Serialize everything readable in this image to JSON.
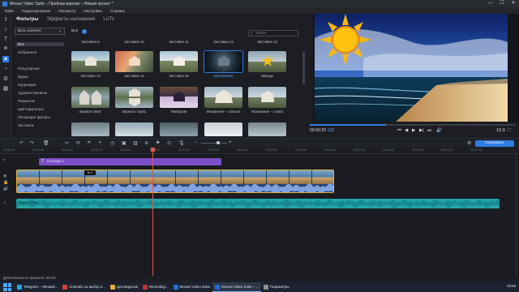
{
  "window": {
    "title": "Movavi Video Suite – Пробная версия – Новый проект *",
    "controls": [
      "—",
      "☐",
      "✕"
    ]
  },
  "menu": [
    "Файл",
    "Редактирование",
    "Просмотр",
    "Настройки",
    "Справка"
  ],
  "library": {
    "tabs": [
      "Фильтры",
      "Эффекты наложения",
      "LUTs"
    ],
    "active_tab": "Фильтры",
    "category_select": "Весь контент",
    "categories": [
      "Все",
      "Избранное",
      "Популярные",
      "Шумы",
      "Коррекция",
      "Художественные",
      "Размытие",
      "Цветофильтры",
      "Летающие фигуры",
      "Заставка"
    ],
    "selected_category": "Все",
    "all_label": "Все",
    "help": "?",
    "search_placeholder": "Поиск",
    "top_row_labels": [
      "Заставка 9",
      "Заставка 10",
      "Заставка 11",
      "Заставка 12",
      "Заставка 13"
    ],
    "effects": [
      {
        "label": "Заставка 14"
      },
      {
        "label": "Заставка 15"
      },
      {
        "label": "Заставка 16"
      },
      {
        "label": "Затемнение",
        "selected": true
      },
      {
        "label": "Звезды"
      },
      {
        "label": "Зеркало верт."
      },
      {
        "label": "Зеркало гориз."
      },
      {
        "label": "Инверсия"
      },
      {
        "label": "Искажение – сильно"
      },
      {
        "label": "Искажение – слабо"
      }
    ]
  },
  "player": {
    "timecode": "00:00:25",
    "timecode_ms": "120",
    "progress": 0.37,
    "aspect": "16:9",
    "controls": [
      "⏮",
      "◀",
      "▶",
      "▶|",
      "⏭",
      "🔊"
    ]
  },
  "timeline": {
    "export_label": "Сохранить",
    "ruler": [
      "00:00:00",
      "00:00:05",
      "00:00:10",
      "00:00:15",
      "00:00:20",
      "00:00:25",
      "00:00:30",
      "00:00:35",
      "00:00:40",
      "00:00:45",
      "00:00:50",
      "00:00:55",
      "00:01:00",
      "00:01:05",
      "00:01:10",
      "00:01:15",
      "00:01:20"
    ],
    "title_clip": "Солнце 1",
    "audio_clip": "Laurent.mp3",
    "fx_badge": "fx 1"
  },
  "status": {
    "duration": "Длительность проекта: 02:16",
    "zoom": "—●—"
  },
  "taskbar": {
    "items": [
      {
        "label": "Telegram – Личный...",
        "color": "#2aa3e6",
        "active": false
      },
      {
        "label": "Спасибо за выбор п...",
        "color": "#d04336",
        "active": false
      },
      {
        "label": "Для видосов",
        "color": "#e5b03b",
        "active": false
      },
      {
        "label": "Recording...",
        "color": "#c23131",
        "active": false
      },
      {
        "label": "Movavi Video Suite",
        "color": "#1f6fd6",
        "active": false
      },
      {
        "label": "Movavi Video Suite – ...",
        "color": "#1f6fd6",
        "active": true
      },
      {
        "label": "Параметры",
        "color": "#8b8f97",
        "active": false
      }
    ],
    "tray_time": "20:56"
  }
}
